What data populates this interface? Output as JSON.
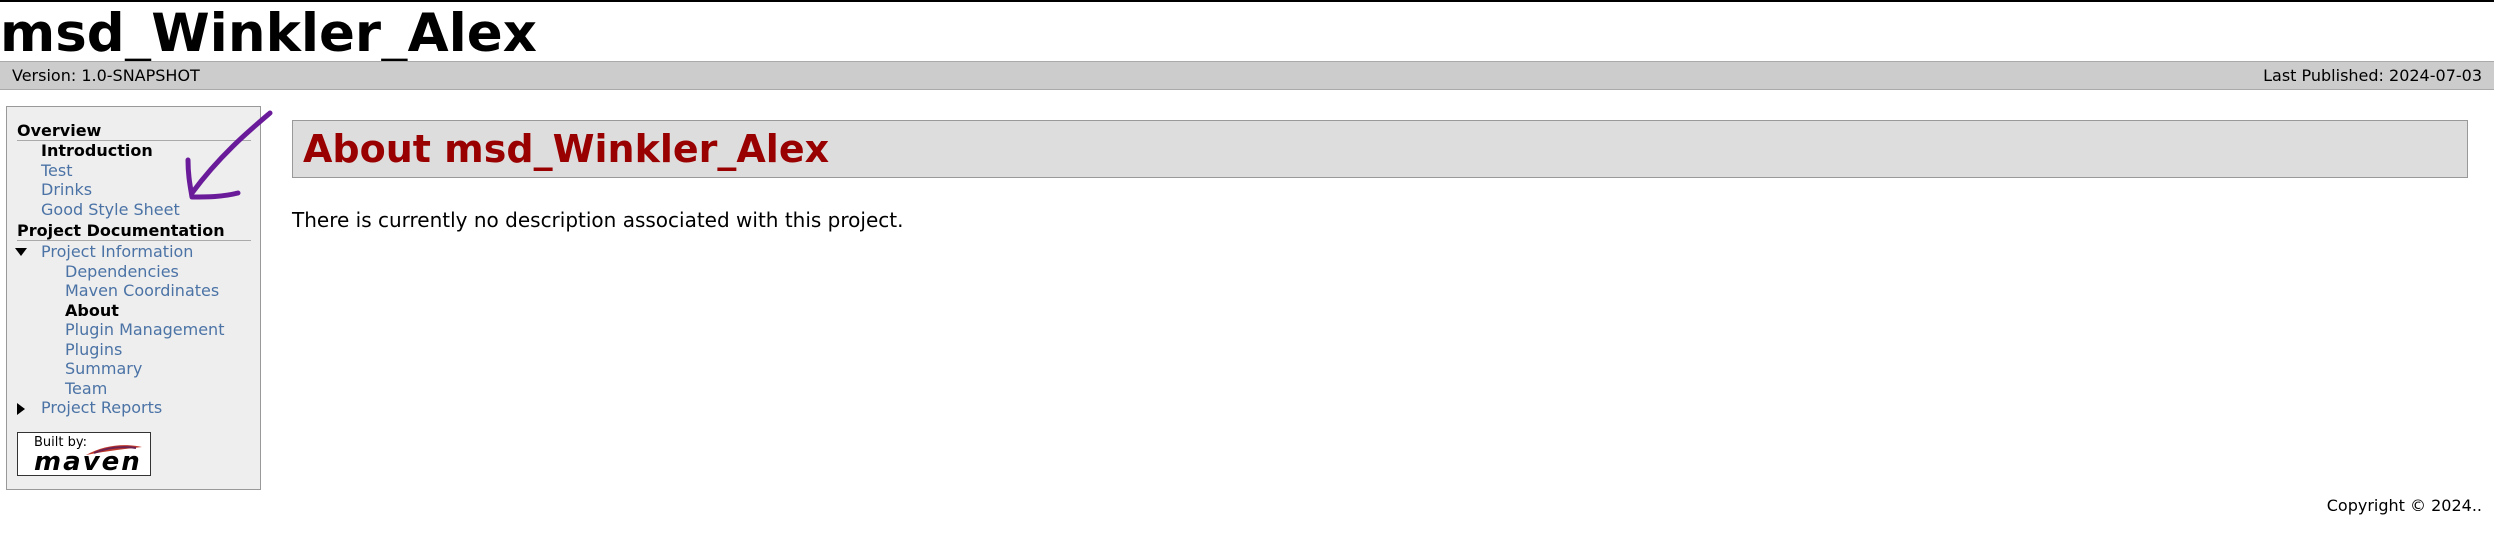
{
  "site": {
    "title": "msd_Winkler_Alex"
  },
  "breadcrumbs": {
    "version": "Version: 1.0-SNAPSHOT",
    "published": "Last Published: 2024-07-03"
  },
  "sidebar": {
    "overview_heading": "Overview",
    "overview_items": [
      {
        "label": "Introduction",
        "active": true
      },
      {
        "label": "Test",
        "active": false
      },
      {
        "label": "Drinks",
        "active": false
      },
      {
        "label": "Good Style Sheet",
        "active": false
      }
    ],
    "docs_heading": "Project Documentation",
    "project_info": "Project Information",
    "project_info_items": [
      {
        "label": "Dependencies",
        "active": false
      },
      {
        "label": "Maven Coordinates",
        "active": false
      },
      {
        "label": "About",
        "active": true
      },
      {
        "label": "Plugin Management",
        "active": false
      },
      {
        "label": "Plugins",
        "active": false
      },
      {
        "label": "Summary",
        "active": false
      },
      {
        "label": "Team",
        "active": false
      }
    ],
    "project_reports": "Project Reports",
    "badge": {
      "built_by": "Built by:",
      "maven": "maven"
    }
  },
  "content": {
    "title": "About msd_Winkler_Alex",
    "description": "There is currently no description associated with this project."
  },
  "footer": {
    "copyright": "Copyright © 2024.."
  },
  "colors": {
    "link": "#4b73a6",
    "title_red": "#990000",
    "breadcrumb_bg": "#cccccc",
    "sidebar_bg": "#eeeeee",
    "annotation_arrow": "#6a1b9a"
  }
}
